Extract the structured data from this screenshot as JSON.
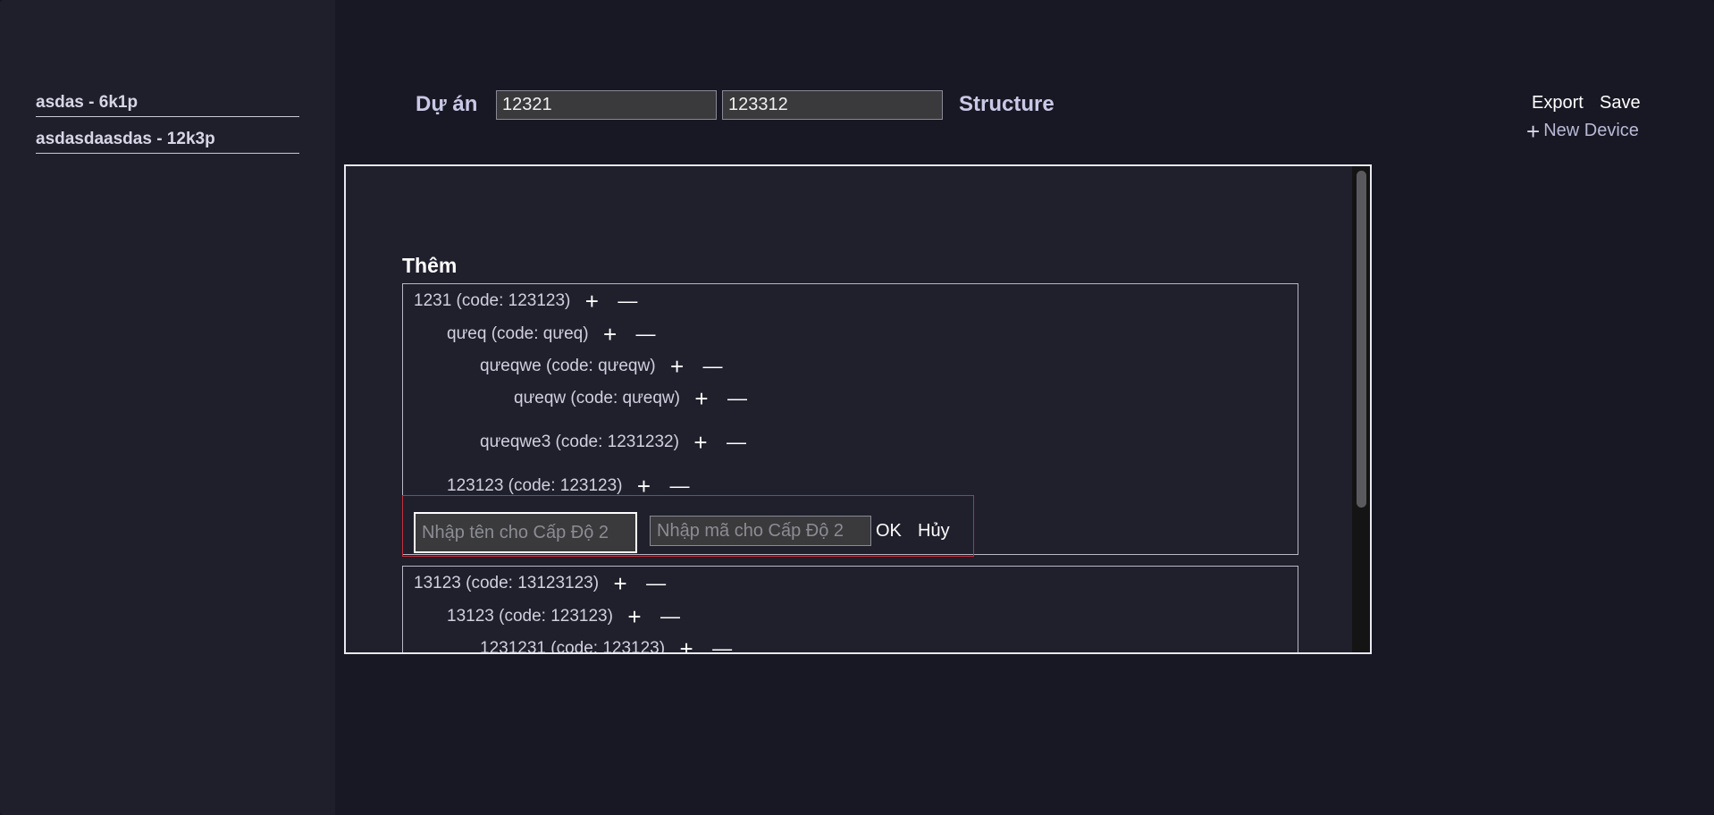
{
  "sidebar": {
    "items": [
      {
        "label": "asdas - 6k1p"
      },
      {
        "label": "asdasdaasdas - 12k3p"
      }
    ]
  },
  "header": {
    "project_label": "Dự án",
    "project_value_1": "12321",
    "project_value_2": "123312",
    "structure_label": "Structure",
    "export_label": "Export",
    "save_label": "Save",
    "new_device_label": "New Device"
  },
  "panel": {
    "title": "Thêm",
    "tree1": [
      {
        "label": "1231 (code: 123123)"
      },
      {
        "label": "qưeq (code: qưeq)"
      },
      {
        "label": "qưeqwe (code: qưeqw)"
      },
      {
        "label": "qưeqw (code: qưeqw)"
      },
      {
        "label": "qưeqwe3 (code: 1231232)"
      },
      {
        "label": "123123 (code: 123123)"
      }
    ],
    "form": {
      "name_placeholder": "Nhập tên cho Cấp Độ 2",
      "code_placeholder": "Nhập mã cho Cấp Độ 2",
      "ok_label": "OK",
      "cancel_label": "Hủy"
    },
    "tree2": [
      {
        "label": "13123 (code: 13123123)"
      },
      {
        "label": "13123 (code: 123123)"
      },
      {
        "label": "1231231 (code: 123123)"
      }
    ]
  },
  "icons": {
    "add": "plus-icon",
    "remove": "minus-icon"
  },
  "colors": {
    "background": "#181824",
    "sidebar": "#1f1f2c",
    "panel": "#20202d",
    "form_border": "#c0303c"
  }
}
